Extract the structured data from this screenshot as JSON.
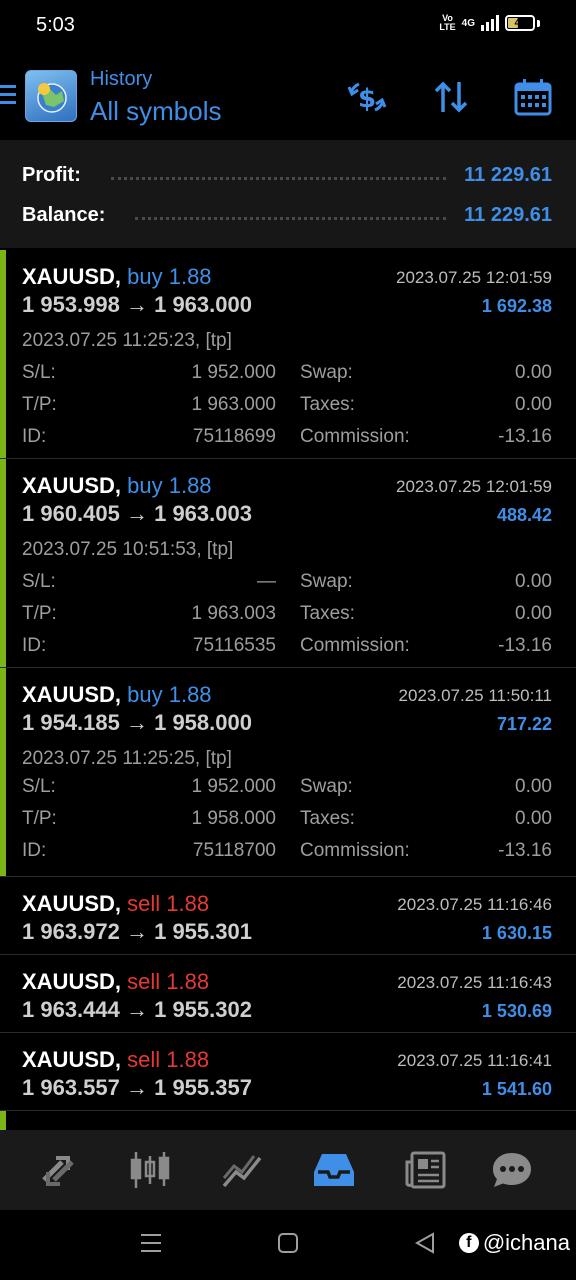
{
  "status": {
    "time": "5:03",
    "volte_top": "Vo",
    "volte_bottom": "LTE",
    "network": "4G",
    "battery": "44"
  },
  "header": {
    "subtitle": "History",
    "title": "All symbols",
    "actions": [
      {
        "icon": "deposit-dollar-icon"
      },
      {
        "icon": "sort-icon"
      },
      {
        "icon": "calendar-icon"
      }
    ]
  },
  "summary": {
    "profit_label": "Profit:",
    "profit_value": "11 229.61",
    "balance_label": "Balance:",
    "balance_value": "11 229.61"
  },
  "trades": [
    {
      "symbol": "XAUUSD,",
      "type": "buy 1.88",
      "prices": "1 953.998 → 1 963.000",
      "close_time": "2023.07.25 12:01:59",
      "profit": "1 692.38",
      "open_time": "2023.07.25 11:25:23, [tp]",
      "sl_label": "S/L:",
      "sl": "1 952.000",
      "tp_label": "T/P:",
      "tp": "1 963.000",
      "id_label": "ID:",
      "id": "75118699",
      "swap_label": "Swap:",
      "swap": "0.00",
      "taxes_label": "Taxes:",
      "taxes": "0.00",
      "commission_label": "Commission:",
      "commission": "-13.16"
    },
    {
      "symbol": "XAUUSD,",
      "type": "buy 1.88",
      "prices": "1 960.405 → 1 963.003",
      "close_time": "2023.07.25 12:01:59",
      "profit": "488.42",
      "open_time": "2023.07.25 10:51:53, [tp]",
      "sl_label": "S/L:",
      "sl": "—",
      "tp_label": "T/P:",
      "tp": "1 963.003",
      "id_label": "ID:",
      "id": "75116535",
      "swap_label": "Swap:",
      "swap": "0.00",
      "taxes_label": "Taxes:",
      "taxes": "0.00",
      "commission_label": "Commission:",
      "commission": "-13.16"
    },
    {
      "symbol": "XAUUSD,",
      "type": "buy 1.88",
      "prices": "1 954.185 → 1 958.000",
      "close_time": "2023.07.25 11:50:11",
      "profit": "717.22",
      "open_time": "2023.07.25 11:25:25, [tp]",
      "sl_label": "S/L:",
      "sl": "1 952.000",
      "tp_label": "T/P:",
      "tp": "1 958.000",
      "id_label": "ID:",
      "id": "75118700",
      "swap_label": "Swap:",
      "swap": "0.00",
      "taxes_label": "Taxes:",
      "taxes": "0.00",
      "commission_label": "Commission:",
      "commission": "-13.16"
    },
    {
      "symbol": "XAUUSD,",
      "type": "sell 1.88",
      "prices": "1 963.972 → 1 955.301",
      "close_time": "2023.07.25 11:16:46",
      "profit": "1 630.15"
    },
    {
      "symbol": "XAUUSD,",
      "type": "sell 1.88",
      "prices": "1 963.444 → 1 955.302",
      "close_time": "2023.07.25 11:16:43",
      "profit": "1 530.69"
    },
    {
      "symbol": "XAUUSD,",
      "type": "sell 1.88",
      "prices": "1 963.557 → 1 955.357",
      "close_time": "2023.07.25 11:16:41",
      "profit": "1 541.60"
    }
  ],
  "nav": {
    "items": [
      {
        "icon": "quotes-icon"
      },
      {
        "icon": "chart-candles-icon"
      },
      {
        "icon": "trade-icon"
      },
      {
        "icon": "history-icon",
        "active": true
      },
      {
        "icon": "news-icon"
      },
      {
        "icon": "chat-icon"
      }
    ]
  },
  "watermark": {
    "fb": "f",
    "handle": "@ichana"
  },
  "colors": {
    "accent": "#3f8fe8",
    "sell": "#e53935",
    "expanded_marker": "#7cb518",
    "background": "#000000"
  }
}
